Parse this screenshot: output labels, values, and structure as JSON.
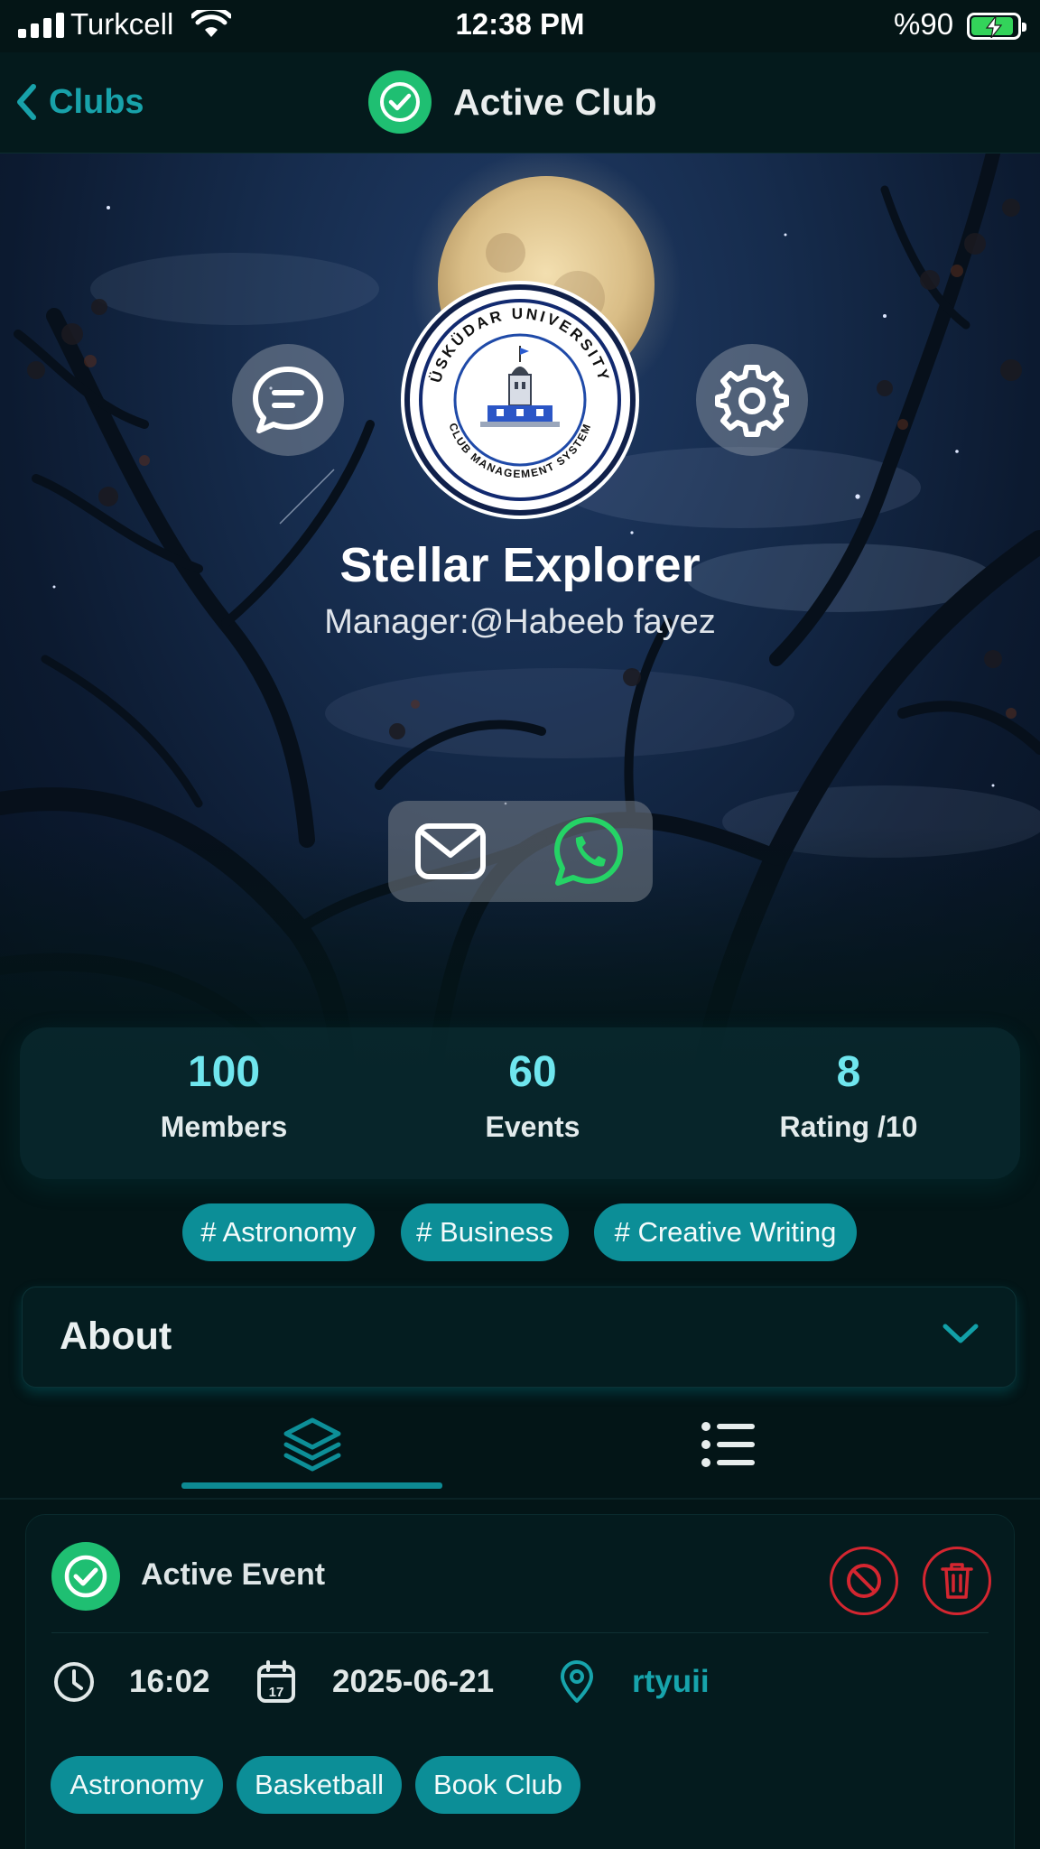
{
  "status_bar": {
    "carrier": "Turkcell",
    "time": "12:38 PM",
    "battery": "%90",
    "battery_level": 0.9,
    "icons": [
      "signal-icon",
      "wifi-icon",
      "battery-charging-icon"
    ]
  },
  "nav": {
    "back_label": "Clubs",
    "title": "Active Club",
    "icons": [
      "chevron-left-icon",
      "check-circle-icon"
    ]
  },
  "club": {
    "name": "Stellar Explorer",
    "manager": "Manager:@Habeeb fayez",
    "logo": {
      "top_text": "ÜSKÜDAR UNIVERSITY",
      "bottom_text": "CLUB MANAGEMENT SYSTEM"
    },
    "actions": [
      "chat-icon",
      "settings-gear-icon"
    ],
    "contacts": [
      "email-icon",
      "whatsapp-icon"
    ]
  },
  "stats": [
    {
      "value": "100",
      "label": "Members"
    },
    {
      "value": "60",
      "label": "Events"
    },
    {
      "value": "8",
      "label": "Rating /10"
    }
  ],
  "tags": [
    "# Astronomy",
    "# Business",
    "# Creative Writing"
  ],
  "about": {
    "label": "About",
    "icon": "chevron-down-icon"
  },
  "tabs": [
    {
      "icon": "layers-icon",
      "selected": true
    },
    {
      "icon": "list-icon",
      "selected": false
    }
  ],
  "event": {
    "status": "Active Event",
    "time": "16:02",
    "date": "2025-06-21",
    "location": "rtyuii",
    "icons": [
      "check-circle-icon",
      "block-icon",
      "trash-icon",
      "clock-icon",
      "calendar-icon",
      "location-pin-icon"
    ],
    "categories": [
      "Astronomy",
      "Basketball",
      "Book Club"
    ]
  },
  "colors": {
    "background": "#031517",
    "accent_teal": "#0c8e97",
    "stat_value": "#6fe6ee",
    "active_green": "#1fbf72",
    "danger_red": "#d42630",
    "whatsapp_green": "#25d366"
  }
}
